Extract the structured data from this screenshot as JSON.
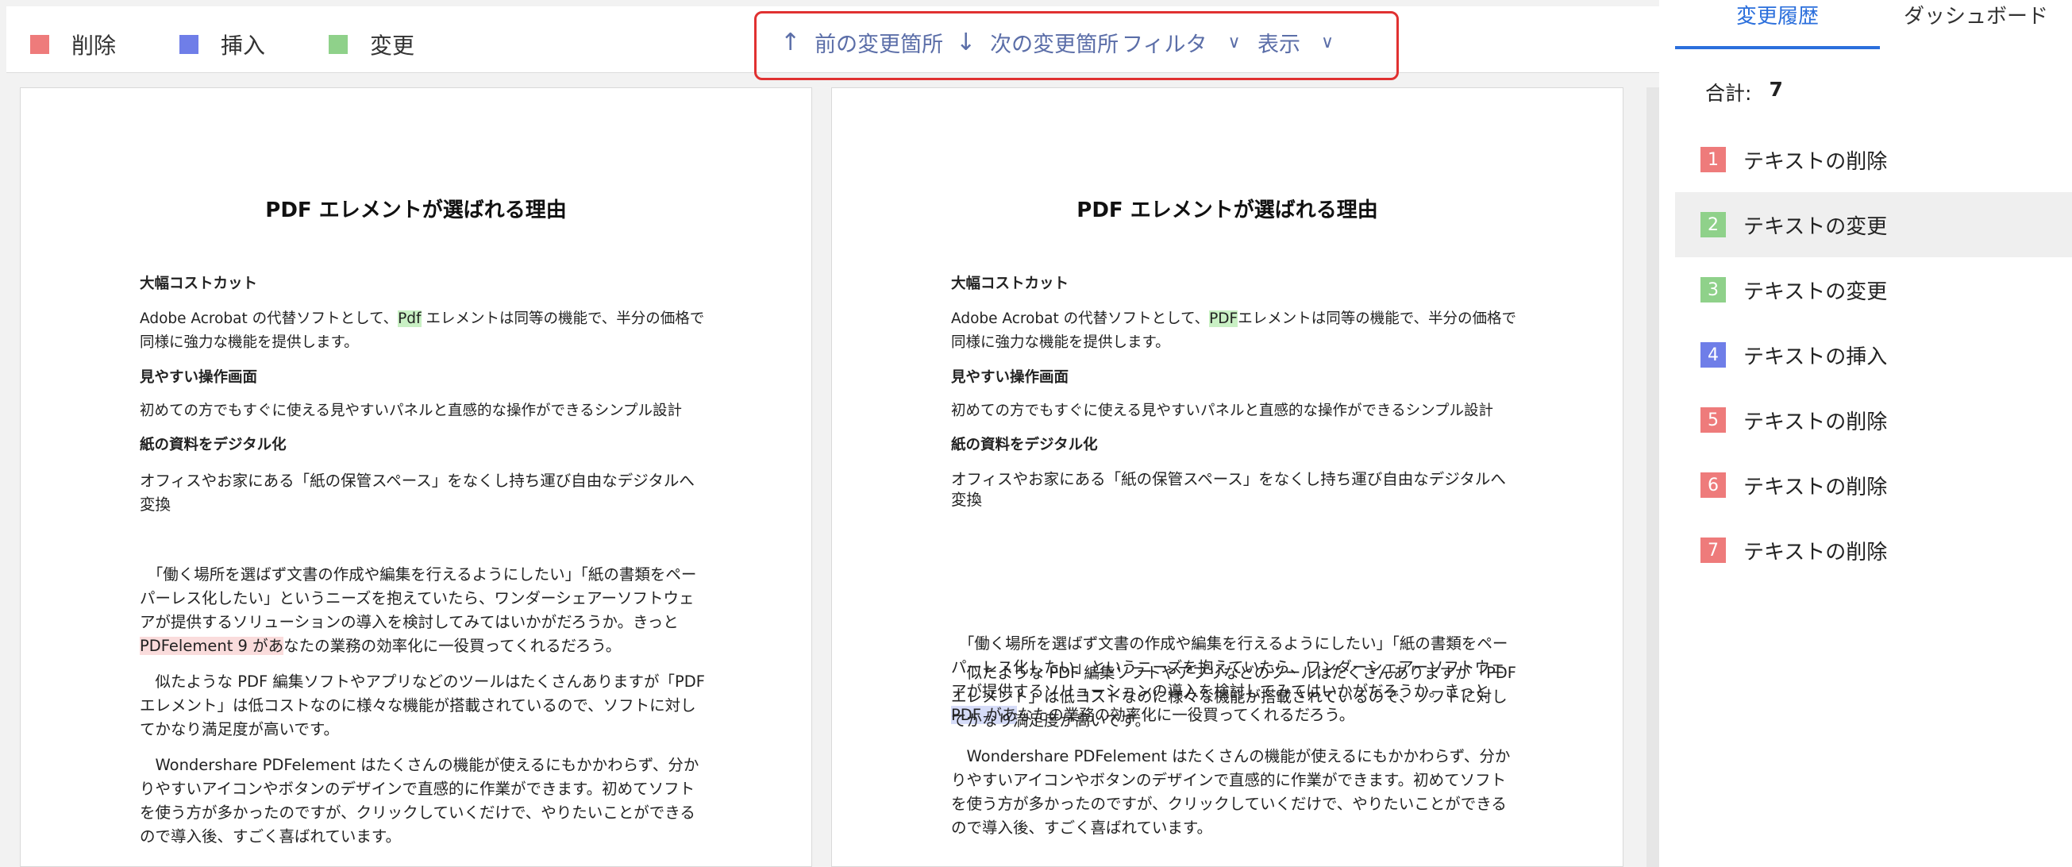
{
  "colors": {
    "delete": "#ee7b7b",
    "insert": "#6f7ee8",
    "change": "#8fd18a",
    "accent": "#2b6fdc",
    "nav_border": "#e03131"
  },
  "legend": [
    {
      "label": "削除",
      "color": "#ee7b7b"
    },
    {
      "label": "挿入",
      "color": "#6f7ee8"
    },
    {
      "label": "変更",
      "color": "#8fd18a"
    }
  ],
  "nav": {
    "prev_label": "前の変更箇所",
    "next_label": "次の変更箇所",
    "filter_label": "フィルタ",
    "view_label": "表示"
  },
  "doc_left": {
    "title": "PDF エレメントが選ばれる理由",
    "h1": "大幅コストカット",
    "p1a": "Adobe Acrobat の代替ソフトとして、",
    "p1hl": "Pdf",
    "p1b": " エレメントは同等の機能で、半分の価格で同様に強力な機能を提供します。",
    "h2": "見やすい操作画面",
    "h2b": "初めての方でもすぐに使える見やすいパネルと直感的な操作ができるシンプル設計",
    "h3": "紙の資料をデジタル化",
    "p3": "オフィスやお家にある「紙の保管スペース」をなくし持ち運び自由なデジタルへ変換",
    "p4a": "　「働く場所を選ばず文書の作成や編集を行えるようにしたい」「紙の書類をペーパーレス化したい」というニーズを抱えていたら、ワンダーシェアーソフトウェアが提供するソリューションの導入を検討してみてはいかがだろうか。きっと",
    "p4hl": "PDFelement 9 があ",
    "p4b": "なたの業務の効率化に一役買ってくれるだろう。",
    "p5": "　似たような PDF 編集ソフトやアプリなどのツールはたくさんありますが「PDF エレメント」は低コストなのに様々な機能が搭載されているので、ソフトに対してかなり満足度が高いです。",
    "p6": "　Wondershare PDFelement はたくさんの機能が使えるにもかかわらず、分かりやすいアイコンやボタンのデザインで直感的に作業ができます。初めてソフトを使う方が多かったのですが、クリックしていくだけで、やりたいことができるので導入後、すごく喜ばれています。"
  },
  "doc_right": {
    "title": "PDF エレメントが選ばれる理由",
    "h1": "大幅コストカット",
    "p1a": "Adobe Acrobat の代替ソフトとして、",
    "p1hl": "PDF",
    "p1b": "エレメントは同等の機能で、半分の価格で同様に強力な機能を提供します。",
    "h2": "見やすい操作画面",
    "h2b": "初めての方でもすぐに使える見やすいパネルと直感的な操作ができるシンプル設計",
    "h3": "紙の資料をデジタル化",
    "p3": "オフィスやお家にある「紙の保管スペース」をなくし持ち運び自由なデジタルへ変換",
    "p4a": "　「働く場所を選ばず文書の作成や編集を行えるようにしたい」「紙の書類をペーパーレス化したい」というニーズを抱えていたら、ワンダーシェアーソフトウェアが提供するソリューションの導入を検討してみてはいかがだろうか。きっと ",
    "p4hl": "PDF があ",
    "p4b": "なたの業務の効率化に一役買ってくれるだろう。",
    "p5": "　似たような PDF 編集ソフトやアプリなどのツールはたくさんありますが「PDF エレメント」は低コストなのに様々な機能が搭載されているので、ソフトに対してかなり満足度が高いです。",
    "p6": "　Wondershare PDFelement はたくさんの機能が使えるにもかかわらず、分かりやすいアイコンやボタンのデザインで直感的に作業ができます。初めてソフトを使う方が多かったのですが、クリックしていくだけで、やりたいことができるので導入後、すごく喜ばれています。"
  },
  "panel": {
    "tab_history": "変更履歴",
    "tab_dashboard": "ダッシュボード",
    "total_label": "合計:",
    "total_value": "7",
    "changes": [
      {
        "num": "1",
        "label": "テキストの削除",
        "type": "delete",
        "color": "#ee7b7b"
      },
      {
        "num": "2",
        "label": "テキストの変更",
        "type": "change",
        "color": "#8fd18a"
      },
      {
        "num": "3",
        "label": "テキストの変更",
        "type": "change",
        "color": "#8fd18a"
      },
      {
        "num": "4",
        "label": "テキストの挿入",
        "type": "insert",
        "color": "#6f7ee8"
      },
      {
        "num": "5",
        "label": "テキストの削除",
        "type": "delete",
        "color": "#ee7b7b"
      },
      {
        "num": "6",
        "label": "テキストの削除",
        "type": "delete",
        "color": "#ee7b7b"
      },
      {
        "num": "7",
        "label": "テキストの削除",
        "type": "delete",
        "color": "#ee7b7b"
      }
    ]
  }
}
